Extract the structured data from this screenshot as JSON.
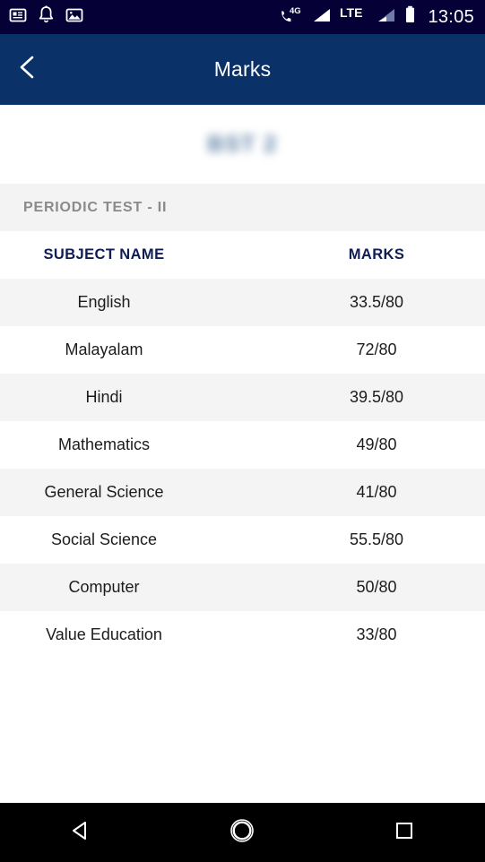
{
  "status_bar": {
    "background": "#050036",
    "left_icons": [
      {
        "name": "news-document-icon"
      },
      {
        "name": "notification-bell-icon"
      },
      {
        "name": "image-photo-icon"
      }
    ],
    "right_icons": [
      {
        "name": "phone-4g-icon",
        "label": "4G"
      },
      {
        "name": "signal-bars-icon"
      },
      {
        "name": "lte-label",
        "label": "LTE"
      },
      {
        "name": "signal-bars-secondary-icon"
      },
      {
        "name": "battery-icon"
      }
    ],
    "time": "13:05"
  },
  "app_bar": {
    "background": "#0b3169",
    "back_icon": "chevron-left-icon",
    "title": "Marks"
  },
  "exam_title": {
    "text": "BST 2",
    "blurred": true
  },
  "section": {
    "header": "PERIODIC TEST - II",
    "background": "#f3f3f3",
    "text_color": "#8a8a8a"
  },
  "table": {
    "header_color": "#0f1d52",
    "columns": [
      "SUBJECT NAME",
      "MARKS"
    ],
    "rows": [
      {
        "subject": "English",
        "marks": "33.5/80"
      },
      {
        "subject": "Malayalam",
        "marks": "72/80"
      },
      {
        "subject": "Hindi",
        "marks": "39.5/80"
      },
      {
        "subject": "Mathematics",
        "marks": "49/80"
      },
      {
        "subject": "General Science",
        "marks": "41/80"
      },
      {
        "subject": "Social Science",
        "marks": "55.5/80"
      },
      {
        "subject": "Computer",
        "marks": "50/80"
      },
      {
        "subject": "Value Education",
        "marks": "33/80"
      }
    ]
  },
  "nav_bar": {
    "background": "#000000",
    "buttons": [
      {
        "name": "back-nav-button"
      },
      {
        "name": "home-nav-button"
      },
      {
        "name": "recents-nav-button"
      }
    ]
  }
}
